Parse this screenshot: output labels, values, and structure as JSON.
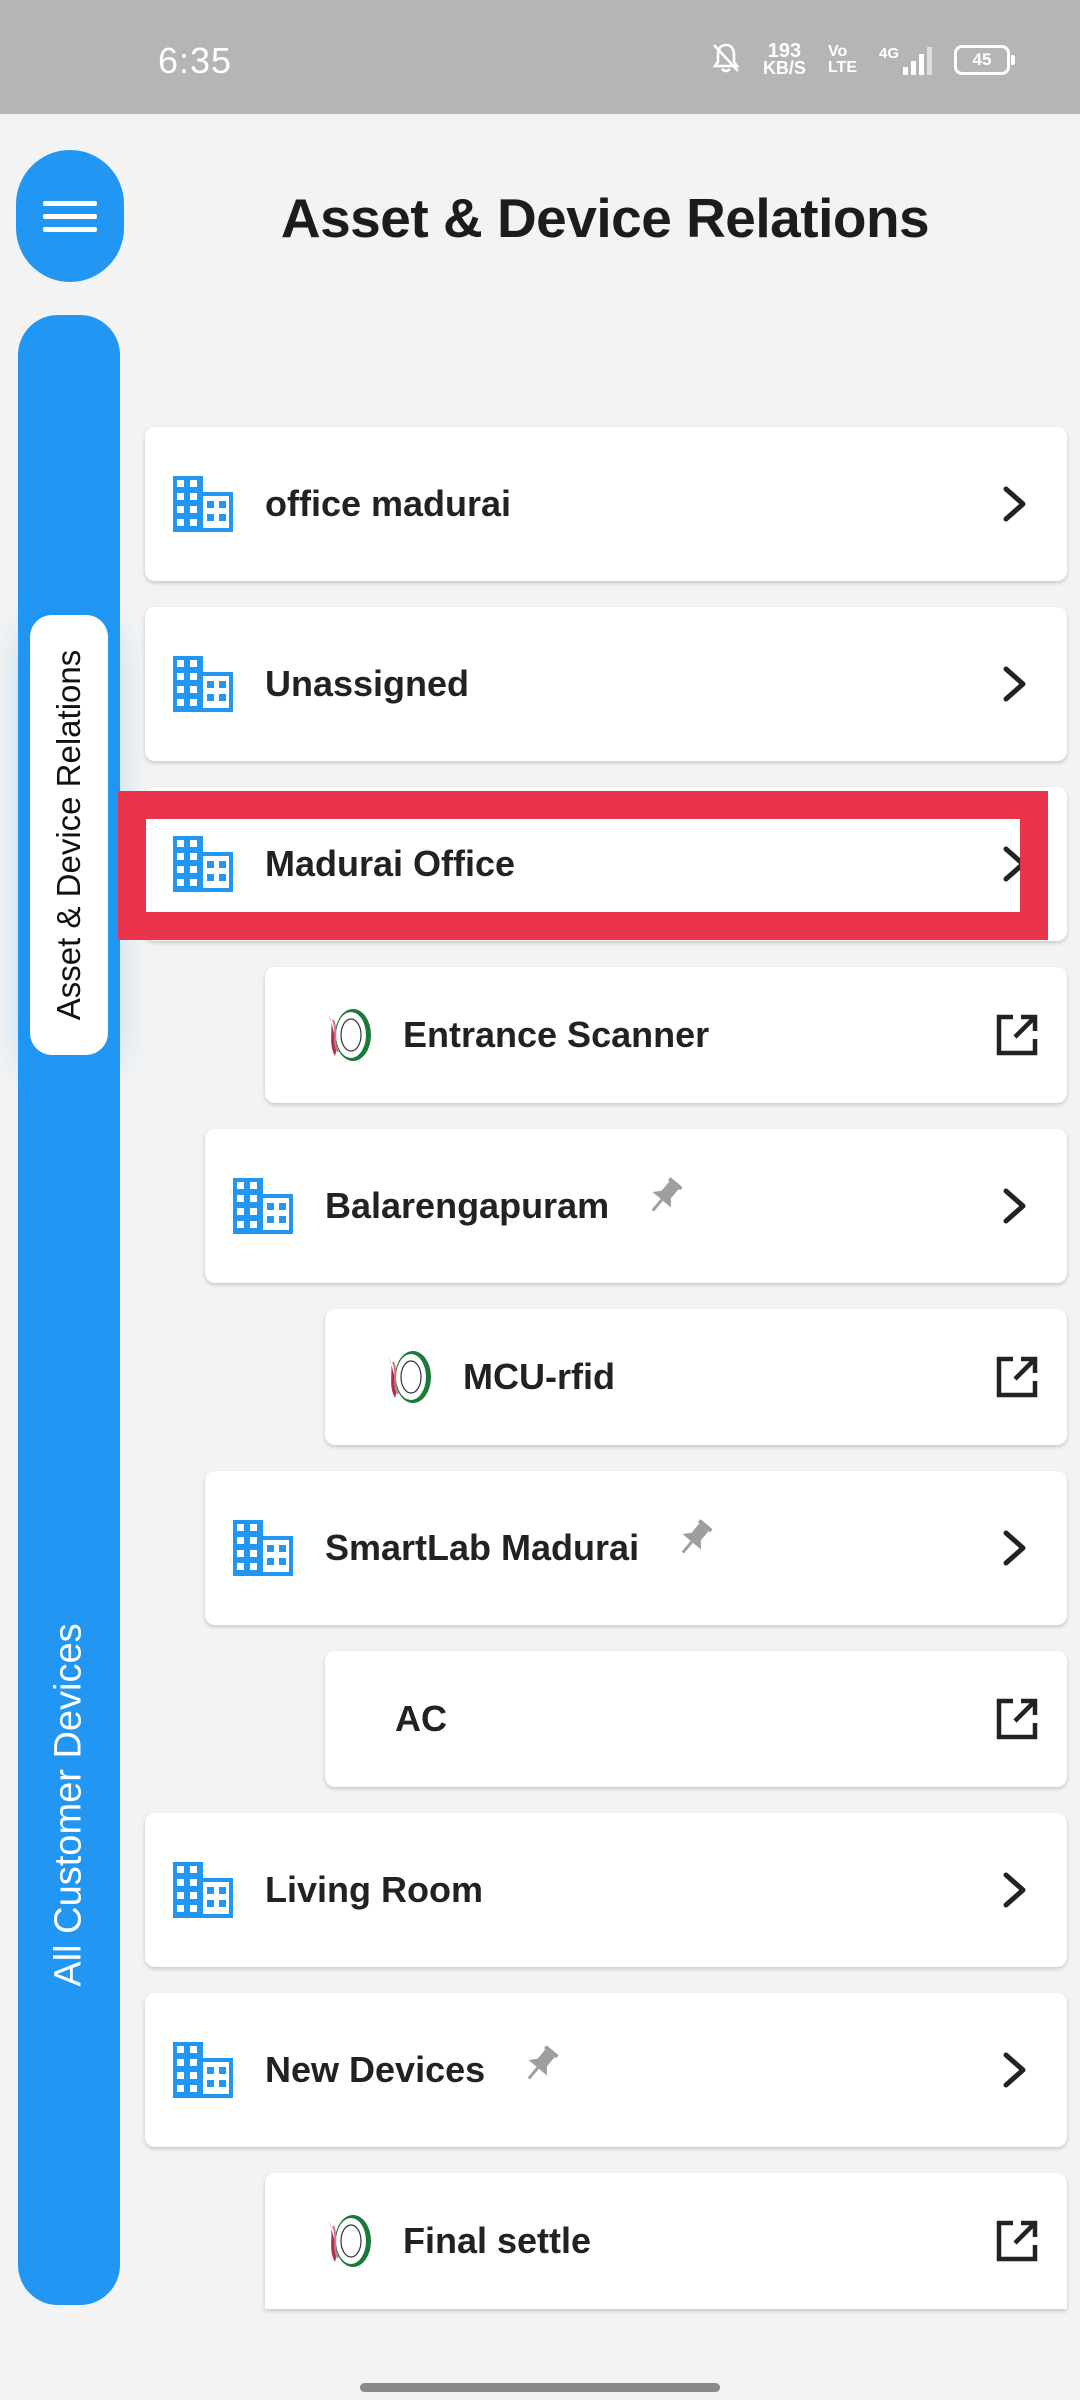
{
  "status_bar": {
    "time": "6:35",
    "net_speed_value": "193",
    "net_speed_unit": "KB/S",
    "volte_top": "Vo",
    "volte_bottom": "LTE",
    "network": "4G",
    "battery": "45"
  },
  "header": {
    "title": "Asset & Device Relations"
  },
  "side_rail": {
    "active_tab": "Asset & Device Relations",
    "other_tab": "All Customer Devices"
  },
  "colors": {
    "accent": "#2196f3",
    "highlight": "#e9334a",
    "pin": "#9e9e9e"
  },
  "list": [
    {
      "label": "office madurai",
      "type": "asset",
      "icon": "building-icon",
      "action": "chevron-right-icon"
    },
    {
      "label": "Unassigned",
      "type": "asset",
      "icon": "building-icon",
      "action": "chevron-right-icon"
    },
    {
      "label": "Madurai Office",
      "type": "asset",
      "icon": "building-icon",
      "action": "chevron-right-icon",
      "highlighted": true
    },
    {
      "label": "Entrance Scanner",
      "type": "device",
      "icon": "device-logo-icon",
      "action": "external-link-icon"
    },
    {
      "label": "Balarengapuram",
      "type": "asset",
      "icon": "building-icon",
      "pinned": true,
      "action": "chevron-right-icon"
    },
    {
      "label": "MCU-rfid",
      "type": "device",
      "icon": "device-logo-icon",
      "action": "external-link-icon"
    },
    {
      "label": "SmartLab Madurai",
      "type": "asset",
      "icon": "building-icon",
      "pinned": true,
      "action": "chevron-right-icon"
    },
    {
      "label": "AC",
      "type": "device",
      "icon": "none",
      "action": "external-link-icon"
    },
    {
      "label": "Living Room",
      "type": "asset",
      "icon": "building-icon",
      "action": "chevron-right-icon"
    },
    {
      "label": "New Devices",
      "type": "asset",
      "icon": "building-icon",
      "pinned": true,
      "action": "chevron-right-icon"
    },
    {
      "label": "Final settle",
      "type": "device",
      "icon": "device-logo-icon",
      "action": "external-link-icon"
    }
  ]
}
